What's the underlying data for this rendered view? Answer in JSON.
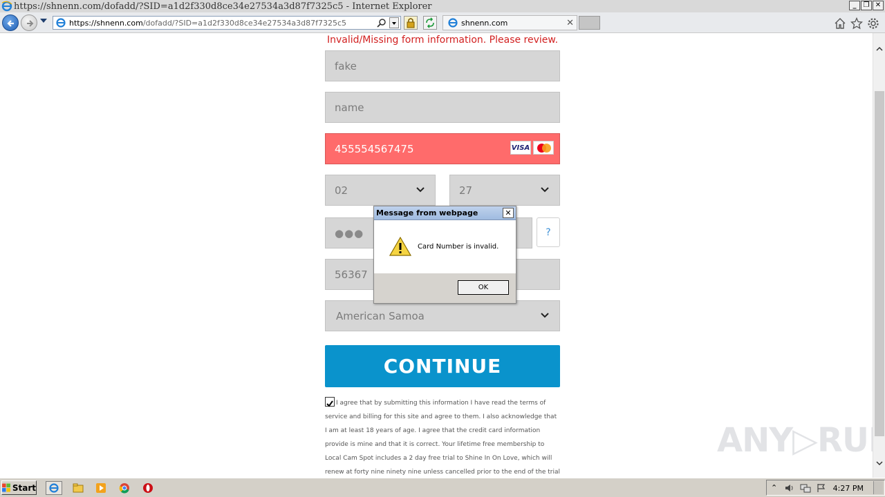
{
  "browser": {
    "window_title": "https://shnenn.com/dofadd/?SID=a1d2f330d8ce34e27534a3d87f7325c5 - Internet Explorer",
    "url_domain": "https://shnenn.com",
    "url_path": "/dofadd/?SID=a1d2f330d8ce34e27534a3d87f7325c5",
    "tab_label": "shnenn.com",
    "window_buttons": [
      "_",
      "❐",
      "✕"
    ]
  },
  "form": {
    "error_message": "Invalid/Missing form information. Please review.",
    "first_name": "fake",
    "last_name": "name",
    "card_number": "455554567475",
    "card_logos": [
      "VISA",
      "mastercard"
    ],
    "exp_month": "02",
    "exp_year": "27",
    "cvv": "●●●",
    "cvv_help": "?",
    "zip": "56367",
    "country": "American Samoa",
    "continue_label": "CONTINUE",
    "agree_checked": true,
    "terms_text": "I agree that by submitting this information I have read the terms of service and billing for this site and agree to them. I also acknowledge that I am at least 18 years of age. I agree that the credit card information provide is mine and that it is correct. Your lifetime free membership to Local Cam Spot includes a 2 day free trial to Shine In On Love, which will renew at forty nine ninety nine unless cancelled prior to the end of the trial period. Your IP address has been recorded to protect"
  },
  "dialog": {
    "title": "Message from webpage",
    "message": "Card Number is invalid.",
    "ok_label": "OK",
    "close_label": "✕"
  },
  "watermark": "ANY▷RUN",
  "taskbar": {
    "start_label": "Start",
    "time": "4:27 PM"
  }
}
